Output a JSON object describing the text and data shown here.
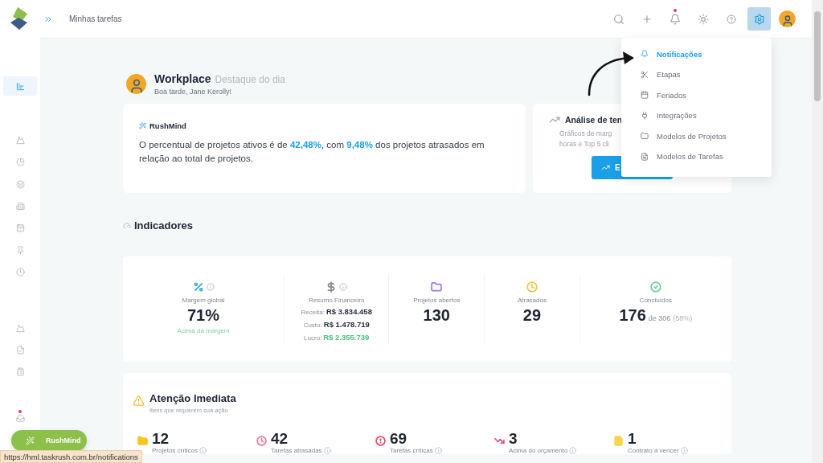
{
  "header": {
    "title": "Minhas tarefas",
    "actions": [
      {
        "kind": "search",
        "selected": false,
        "dot": false
      },
      {
        "kind": "add",
        "selected": false,
        "dot": false
      },
      {
        "kind": "bell",
        "selected": false,
        "dot": true
      },
      {
        "kind": "theme",
        "selected": false,
        "dot": false
      },
      {
        "kind": "help",
        "selected": false,
        "dot": false
      },
      {
        "kind": "settings",
        "selected": true,
        "dot": false
      }
    ]
  },
  "sidebar": {
    "items": [
      {
        "selected": true,
        "dot": false
      },
      {
        "selected": false,
        "dot": false
      },
      {
        "selected": false,
        "dot": false
      },
      {
        "selected": false,
        "dot": false
      },
      {
        "selected": false,
        "dot": false
      },
      {
        "selected": false,
        "dot": false
      },
      {
        "selected": false,
        "dot": false
      },
      {
        "selected": false,
        "dot": false
      },
      {
        "selected": false,
        "dot": false
      },
      {
        "selected": false,
        "dot": false
      },
      {
        "selected": false,
        "dot": false
      },
      {
        "selected": false,
        "dot": true
      }
    ]
  },
  "settings_menu": {
    "items": [
      {
        "label": "Notificações",
        "selected": true
      },
      {
        "label": "Etapas",
        "selected": false
      },
      {
        "label": "Feriados",
        "selected": false
      },
      {
        "label": "Integrações",
        "selected": false
      },
      {
        "label": "Modelos de Projetos",
        "selected": false
      },
      {
        "label": "Modelos de Tarefas",
        "selected": false
      }
    ]
  },
  "workplace": {
    "title": "Workplace",
    "subtitle": "Destaque do dia",
    "greeting": "Boa tarde, Jane Kerolly!"
  },
  "rushmind_card": {
    "title": "RushMind",
    "text": "O percentual de projetos ativos é de **42,48%**, com **9,48%** dos projetos atrasados em relação ao total de projetos."
  },
  "analysis_card": {
    "title": "Análise de ten",
    "description_lines": [
      "Gráficos de marg",
      "horas e Top 5 cli"
    ],
    "button": "E"
  },
  "indicators": {
    "title": "Indicadores",
    "items": [
      {
        "kind": "metric",
        "color": "#3aa7e8",
        "info": true,
        "label": "Margem global",
        "value": "71%",
        "note": "Acima da margem"
      },
      {
        "kind": "finance",
        "color": "#888c94",
        "info": true,
        "label": "Resumo Financeiro",
        "lines": [
          {
            "label": "Receita:",
            "value": "R$ 3.834.458",
            "positive": false
          },
          {
            "label": "Custo:",
            "value": "R$ 1.478.719",
            "positive": false
          },
          {
            "label": "Lucro:",
            "value": "R$ 2.355.739",
            "positive": true
          }
        ]
      },
      {
        "kind": "metric",
        "color": "#9b7be8",
        "info": false,
        "label": "Projetos abertos",
        "value": "130"
      },
      {
        "kind": "metric",
        "color": "#f5c542",
        "info": false,
        "label": "Atrasados",
        "value": "29"
      },
      {
        "kind": "metric",
        "color": "#6fd39a",
        "info": false,
        "label": "Concluídos",
        "value": "176",
        "suffix": "de 306",
        "extra": "(58%)"
      }
    ]
  },
  "attention": {
    "title": "Atenção Imediata",
    "subtitle": "Itens que requerem sua ação",
    "items": [
      {
        "color": "#f5c518",
        "count": "12",
        "label": "Projetos críticos"
      },
      {
        "color": "#f07a9a",
        "count": "42",
        "label": "Tarefas atrasadas"
      },
      {
        "color": "#e84a6a",
        "count": "69",
        "label": "Tarefas críticas"
      },
      {
        "color": "#e8508a",
        "count": "3",
        "label": "Acima do orçamento"
      },
      {
        "color": "#f5d54a",
        "count": "1",
        "label": "Contrato a vencer"
      }
    ]
  },
  "fab": {
    "label": "RushMind"
  },
  "status_url": "https://hml.taskrush.com.br/notifications"
}
